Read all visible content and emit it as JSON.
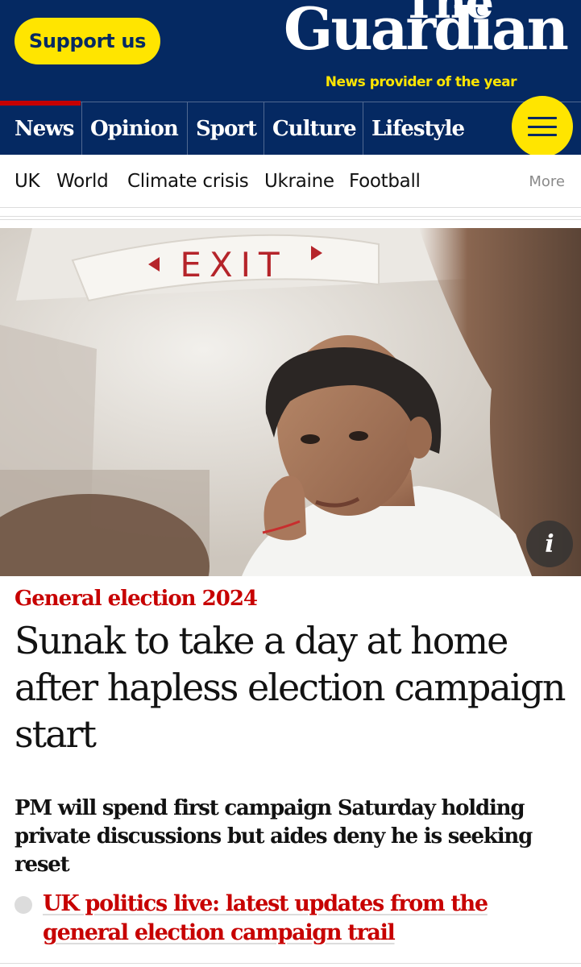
{
  "header": {
    "support_label": "Support us",
    "logo_the": "The",
    "logo_guardian": "Guardian",
    "logo_tagline": "News provider of the year",
    "background": "#052962",
    "accent": "#ffe500"
  },
  "pillars": [
    {
      "label": "News"
    },
    {
      "label": "Opinion"
    },
    {
      "label": "Sport"
    },
    {
      "label": "Culture"
    },
    {
      "label": "Lifestyle"
    }
  ],
  "menu_icon": "hamburger-menu-icon",
  "subnav": {
    "items": [
      {
        "label": "UK"
      },
      {
        "label": "World"
      },
      {
        "label": "Climate crisis"
      },
      {
        "label": "Ukraine"
      },
      {
        "label": "Football"
      }
    ],
    "more_label": "More"
  },
  "hero": {
    "sign_text": "EXIT",
    "info_label": "i"
  },
  "article": {
    "kicker": "General election 2024",
    "kicker_color": "#c70000",
    "headline": "Sunak to take a day at home after hapless election campaign start",
    "standfirst": "PM will spend first campaign Saturday holding private discussions but aides deny he is seeking reset",
    "related_link": "UK politics live: latest updates from the general election campaign trail"
  }
}
